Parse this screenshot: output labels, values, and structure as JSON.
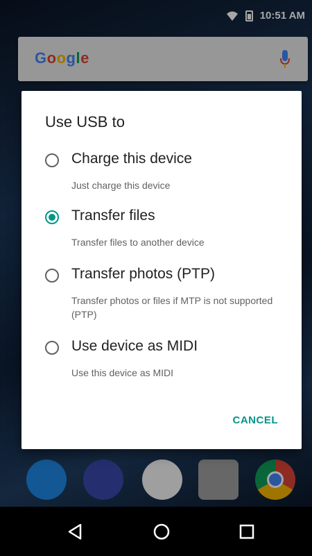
{
  "status_bar": {
    "time": "10:51 AM"
  },
  "search": {
    "brand": "Google"
  },
  "dialog": {
    "title": "Use USB to",
    "options": [
      {
        "label": "Charge this device",
        "description": "Just charge this device",
        "selected": false
      },
      {
        "label": "Transfer files",
        "description": "Transfer files to another device",
        "selected": true
      },
      {
        "label": "Transfer photos (PTP)",
        "description": "Transfer photos or files if MTP is not supported (PTP)",
        "selected": false
      },
      {
        "label": "Use device as MIDI",
        "description": "Use this device as MIDI",
        "selected": false
      }
    ],
    "cancel_label": "CANCEL"
  },
  "colors": {
    "accent": "#009688"
  },
  "dock": {
    "icons": [
      "phone-icon",
      "messages-icon",
      "app-drawer-icon",
      "camera-icon",
      "chrome-icon"
    ]
  },
  "nav": {
    "icons": [
      "back-icon",
      "home-icon",
      "recents-icon"
    ]
  }
}
